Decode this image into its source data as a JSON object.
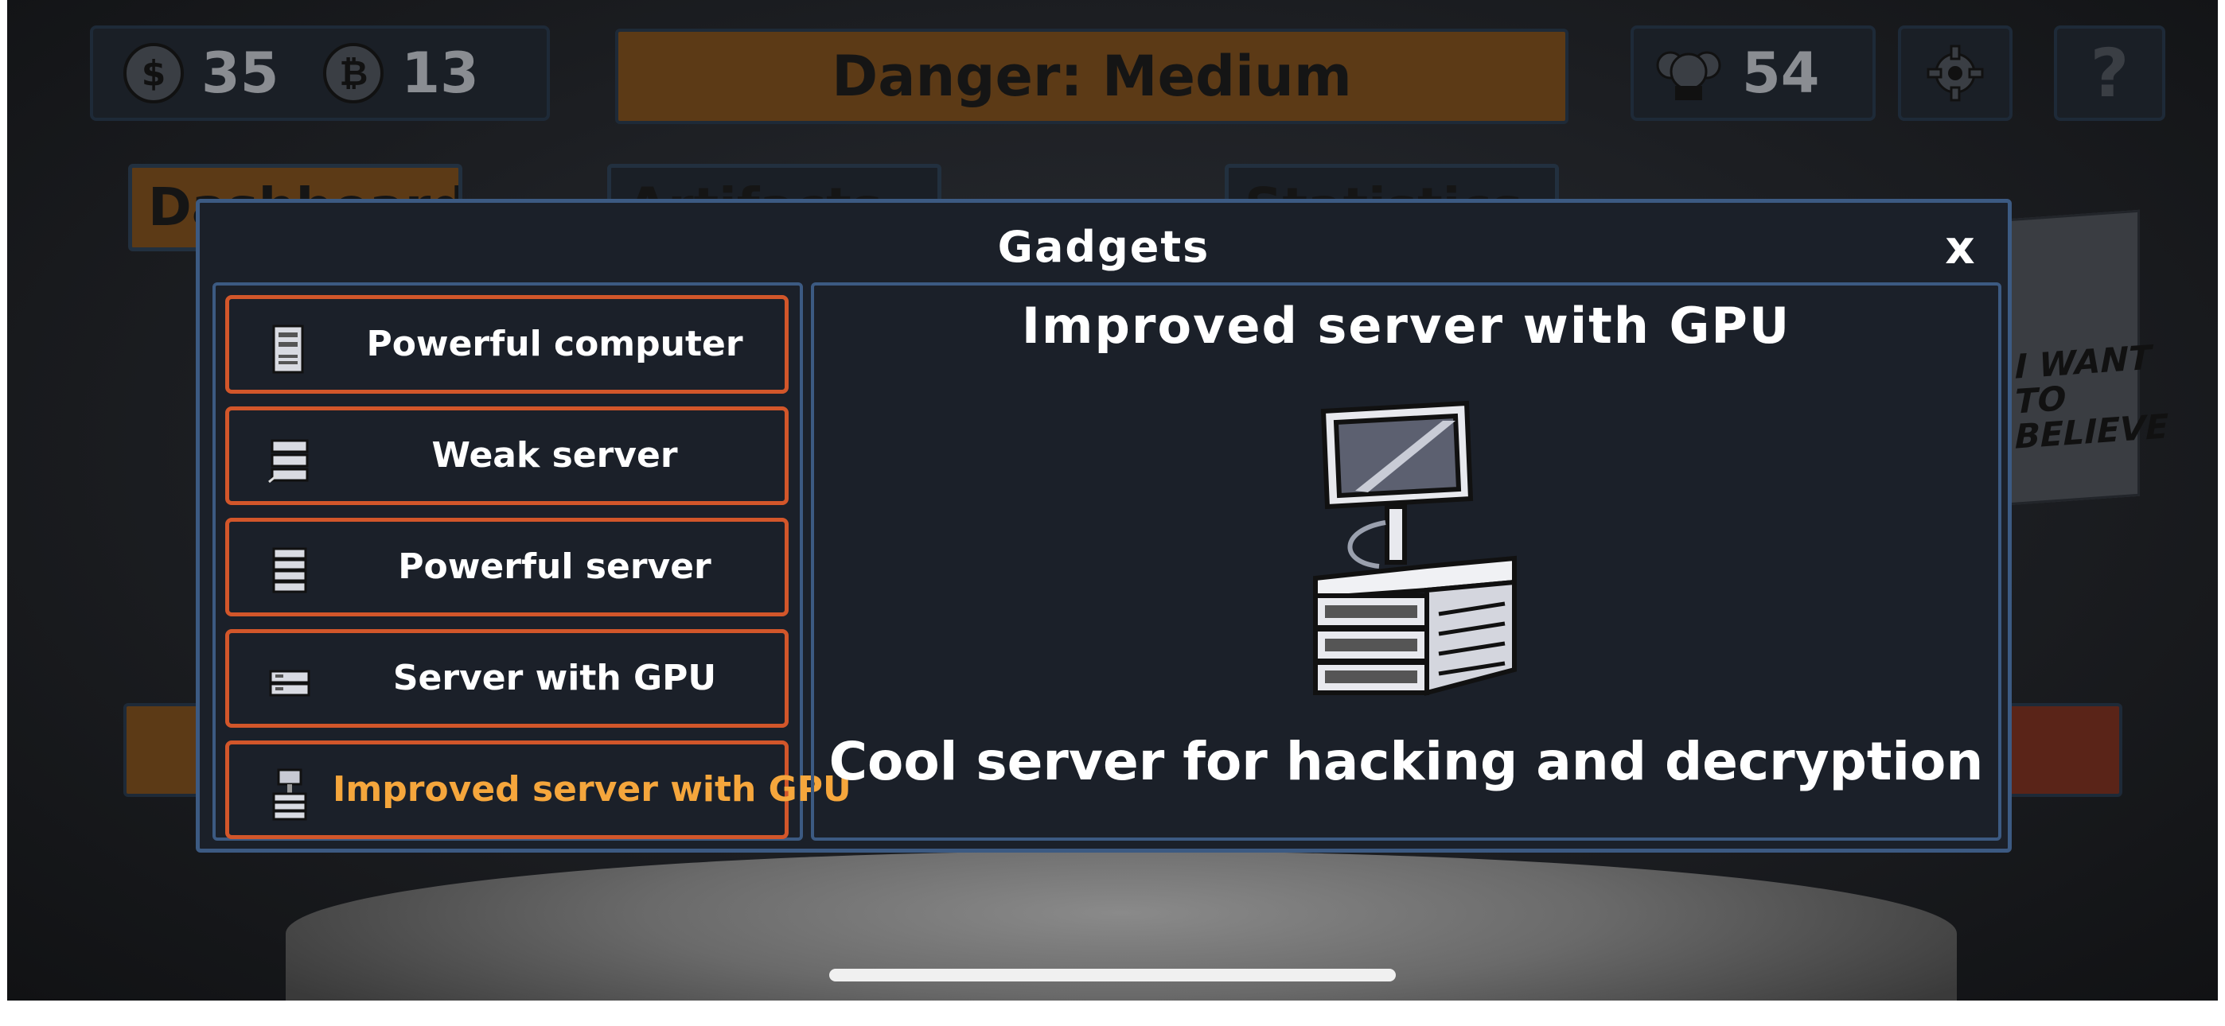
{
  "hud": {
    "money": "35",
    "money_icon": "dollar-coin-icon",
    "bitcoin": "13",
    "bitcoin_icon": "bitcoin-coin-icon",
    "danger_label": "Danger: Medium",
    "followers": "54",
    "followers_icon": "hacker-group-icon",
    "settings_icon": "gear-icon",
    "help_icon": "question-mark-icon"
  },
  "background": {
    "tab_1": "Dashboard",
    "tab_2": "Artifacts",
    "tab_3": "Statistics",
    "poster_text": "I WANT TO BELIEVE"
  },
  "modal": {
    "title": "Gadgets",
    "close_label": "x",
    "items": [
      {
        "label": "Powerful computer",
        "icon": "computer-tower-icon"
      },
      {
        "label": "Weak server",
        "icon": "weak-server-icon"
      },
      {
        "label": "Powerful server",
        "icon": "server-rack-icon"
      },
      {
        "label": "Server with GPU",
        "icon": "gpu-server-icon"
      },
      {
        "label": "Improved server with GPU",
        "icon": "improved-gpu-server-icon"
      }
    ],
    "selected_index": 4,
    "detail": {
      "title": "Improved server with GPU",
      "description": "Cool server for hacking and decryption"
    }
  },
  "colors": {
    "accent_orange": "#d2562a",
    "selected_text": "#f5a63c",
    "panel_border": "#3c5a82",
    "panel_bg": "#1b2029",
    "danger_bg": "#5c3a16"
  }
}
